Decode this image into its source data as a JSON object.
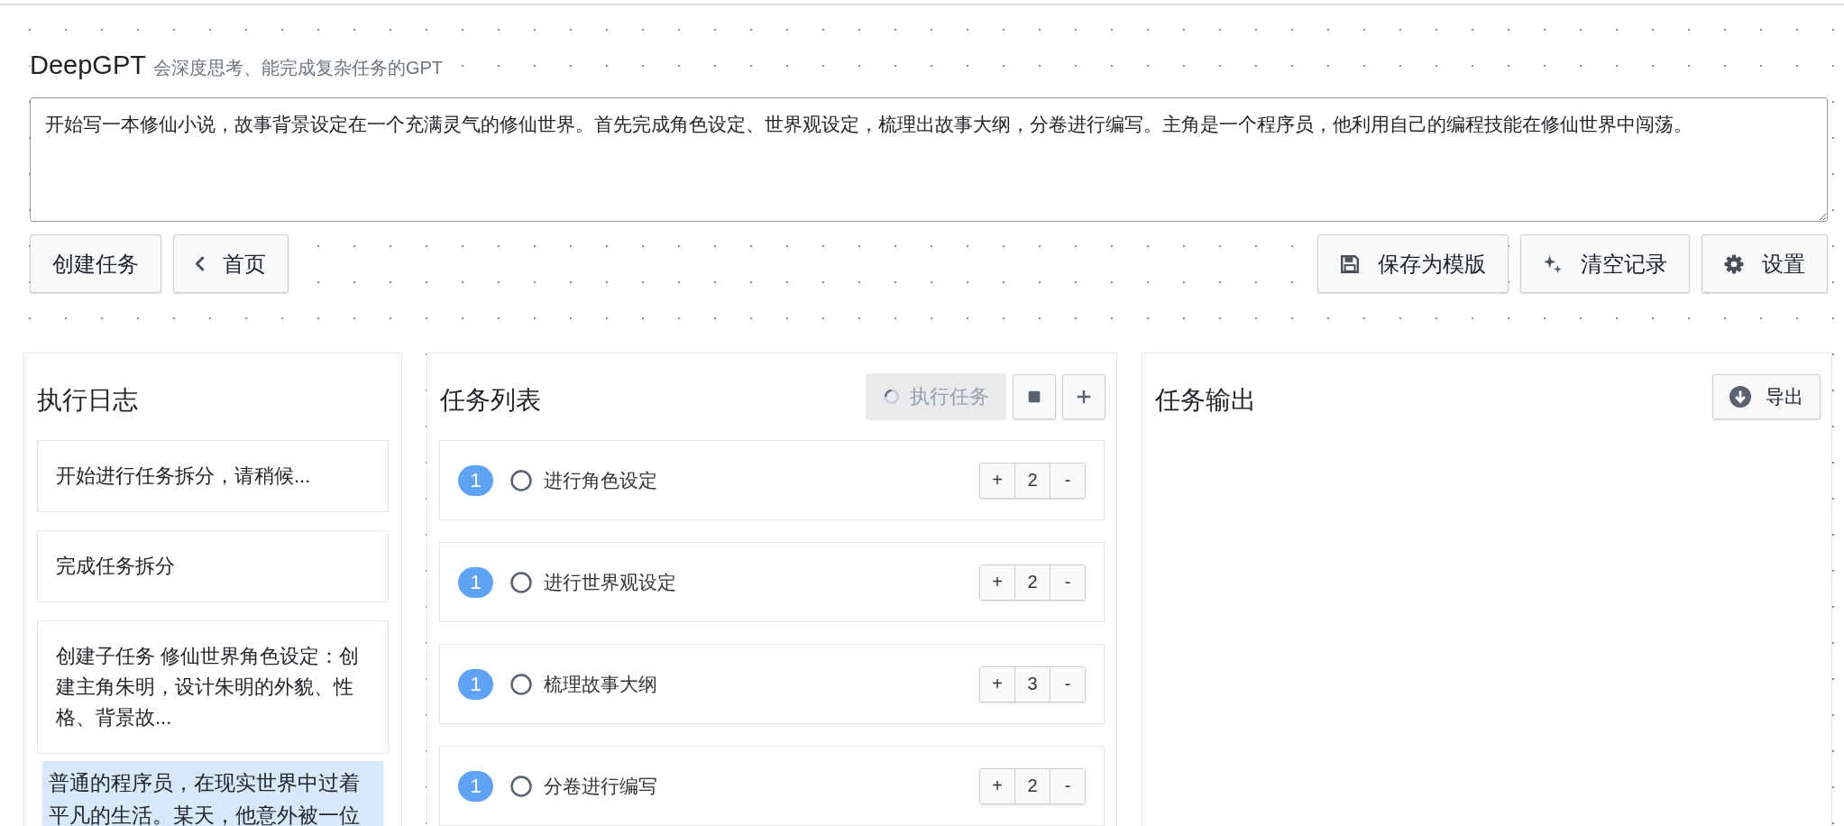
{
  "app": {
    "title": "DeepGPT",
    "subtitle": "会深度思考、能完成复杂任务的GPT"
  },
  "prompt": {
    "value": "开始写一本修仙小说，故事背景设定在一个充满灵气的修仙世界。首先完成角色设定、世界观设定，梳理出故事大纲，分卷进行编写。主角是一个程序员，他利用自己的编程技能在修仙世界中闯荡。"
  },
  "toolbar": {
    "left": [
      {
        "label": "创建任务",
        "kind": "plain"
      },
      {
        "label": "首页",
        "kind": "back"
      }
    ],
    "right": [
      {
        "label": "保存为模版",
        "kind": "save"
      },
      {
        "label": "清空记录",
        "kind": "sparkle"
      },
      {
        "label": "设置",
        "kind": "settings"
      }
    ]
  },
  "log_panel": {
    "title": "执行日志",
    "entries": [
      {
        "text": "开始进行任务拆分，请稍候...",
        "highlighted": false
      },
      {
        "text": "完成任务拆分",
        "highlighted": false
      },
      {
        "text": "创建子任务 修仙世界角色设定：创建主角朱明，设计朱明的外貌、性格、背景故...",
        "highlighted": false
      },
      {
        "text": "普通的程序员，在现实世界中过着平凡的生活。某天，他意外被一位",
        "highlighted": true
      }
    ]
  },
  "task_panel": {
    "title": "任务列表",
    "run_button": {
      "label": "执行任务",
      "disabled": true
    },
    "tasks": [
      {
        "badge": "1",
        "name": "进行角色设定",
        "checked": false,
        "increment": "+",
        "count": "2",
        "decrement": "-"
      },
      {
        "badge": "1",
        "name": "进行世界观设定",
        "checked": false,
        "increment": "+",
        "count": "2",
        "decrement": "-"
      },
      {
        "badge": "1",
        "name": "梳理故事大纲",
        "checked": false,
        "increment": "+",
        "count": "3",
        "decrement": "-"
      },
      {
        "badge": "1",
        "name": "分卷进行编写",
        "checked": false,
        "increment": "+",
        "count": "2",
        "decrement": "-"
      }
    ]
  },
  "output_panel": {
    "title": "任务输出",
    "export_button": {
      "label": "导出"
    }
  }
}
